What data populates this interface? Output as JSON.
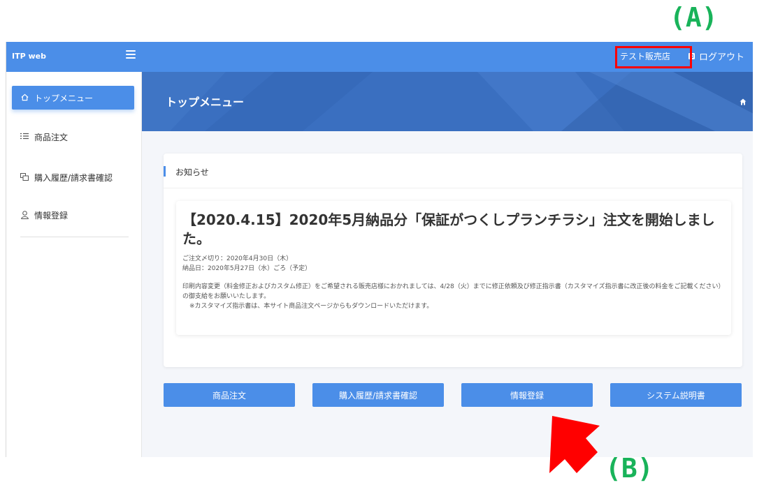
{
  "annotations": {
    "a_label": "(A)",
    "b_label": "(B)"
  },
  "header": {
    "brand": "ITP web",
    "user_name": "テスト販売店",
    "logout_label": "ログアウト"
  },
  "sidebar": {
    "items": [
      {
        "label": "トップメニュー",
        "icon": "home-icon"
      },
      {
        "label": "商品注文",
        "icon": "list-icon"
      },
      {
        "label": "購入履歴/請求書確認",
        "icon": "history-icon"
      },
      {
        "label": "情報登録",
        "icon": "user-icon"
      }
    ]
  },
  "banner": {
    "title": "トップメニュー"
  },
  "notice_card": {
    "header": "お知らせ",
    "title": "【2020.4.15】2020年5月納品分「保証がつくしプランチラシ」注文を開始しました。",
    "deadline": "ご注文〆切り：2020年4月30日（木）",
    "delivery": "納品日：2020年5月27日（水）ごろ（予定）",
    "body": "印刷内容変更（料金修正およびカスタム修正）をご希望される販売店様におかれましては、4/28（火）までに修正依頼及び修正指示書（カスタマイズ指示書に改正後の料金をご記載ください）の御支給をお願いいたします。",
    "note": "※カスタマイズ指示書は、本サイト商品注文ページからもダウンロードいただけます。"
  },
  "buttons": [
    {
      "label": "商品注文"
    },
    {
      "label": "購入履歴/請求書確認"
    },
    {
      "label": "情報登録"
    },
    {
      "label": "システム説明書"
    }
  ],
  "colors": {
    "accent": "#4b8ee8",
    "banner": "#3a6fc0",
    "annotation_green": "#19b35a",
    "annotation_red": "#ff0000"
  }
}
